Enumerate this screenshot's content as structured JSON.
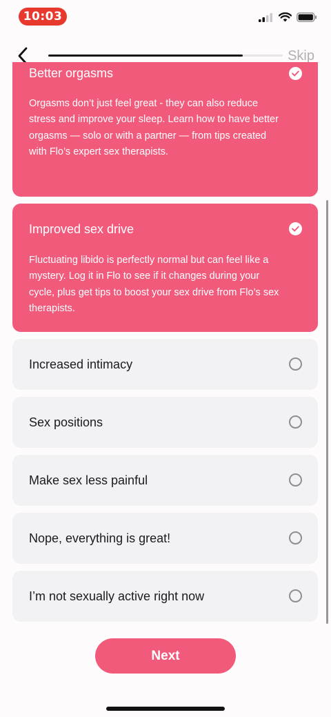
{
  "status_bar": {
    "time": "10:03"
  },
  "nav": {
    "skip_label": "Skip",
    "progress": 0.83
  },
  "options": [
    {
      "title": "Better orgasms",
      "description": "Orgasms don’t just feel great - they can also reduce stress and improve your sleep. Learn how to have better orgasms — solo or with a partner — from tips created with Flo’s expert sex therapists.",
      "selected": true
    },
    {
      "title": "Improved sex drive",
      "description": "Fluctuating libido is perfectly normal but can feel like a mystery. Log it in Flo to see if it changes during your cycle, plus get tips to boost your sex drive from Flo’s sex therapists.",
      "selected": true
    },
    {
      "title": "Increased intimacy",
      "selected": false
    },
    {
      "title": "Sex positions",
      "selected": false
    },
    {
      "title": "Make sex less painful",
      "selected": false
    },
    {
      "title": "Nope, everything is great!",
      "selected": false
    },
    {
      "title": "I’m not sexually active right now",
      "selected": false
    }
  ],
  "next_label": "Next",
  "colors": {
    "accent": "#f25a7b",
    "card_bg": "#f2f1f4",
    "time_pill": "#e8392f"
  },
  "icons": {
    "selected": "checkmark-circle-icon",
    "unselected": "radio-circle-icon"
  }
}
